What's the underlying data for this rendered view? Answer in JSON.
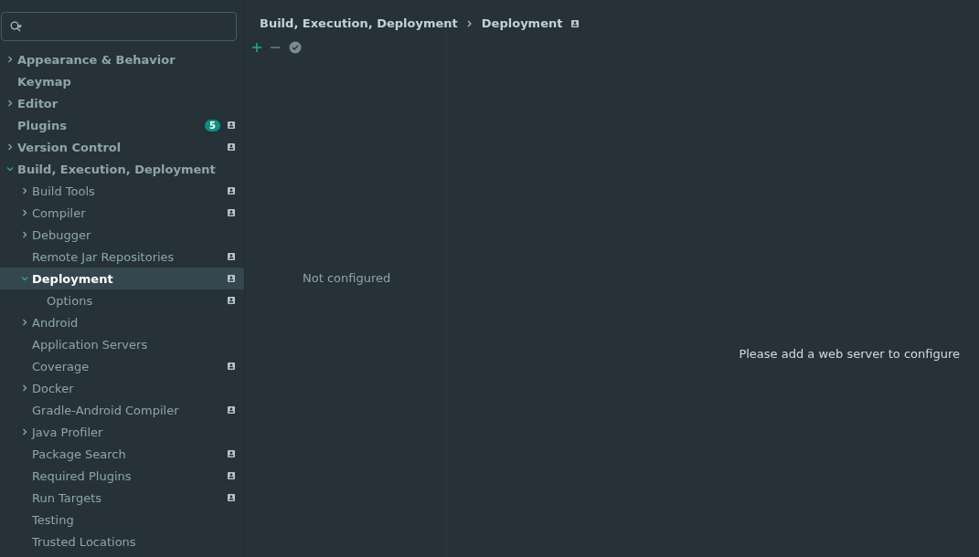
{
  "tree": [
    {
      "label": "Appearance & Behavior",
      "expandable": true,
      "expanded": false,
      "selected": false,
      "project_scope": false
    },
    {
      "label": "Keymap",
      "expandable": false,
      "selected": false,
      "project_scope": false
    },
    {
      "label": "Editor",
      "expandable": true,
      "expanded": false,
      "selected": false,
      "project_scope": false
    },
    {
      "label": "Plugins",
      "expandable": false,
      "selected": false,
      "project_scope": true,
      "badge": "5"
    },
    {
      "label": "Version Control",
      "expandable": true,
      "expanded": false,
      "selected": false,
      "project_scope": true
    },
    {
      "label": "Build, Execution, Deployment",
      "expandable": true,
      "expanded": true,
      "selected": false,
      "project_scope": false,
      "children": [
        {
          "label": "Build Tools",
          "expandable": true,
          "expanded": false,
          "selected": false,
          "project_scope": true
        },
        {
          "label": "Compiler",
          "expandable": true,
          "expanded": false,
          "selected": false,
          "project_scope": true
        },
        {
          "label": "Debugger",
          "expandable": true,
          "expanded": false,
          "selected": false,
          "project_scope": false
        },
        {
          "label": "Remote Jar Repositories",
          "expandable": false,
          "selected": false,
          "project_scope": true
        },
        {
          "label": "Deployment",
          "expandable": true,
          "expanded": true,
          "selected": true,
          "project_scope": true,
          "children": [
            {
              "label": "Options",
              "expandable": false,
              "selected": false,
              "project_scope": true
            }
          ]
        },
        {
          "label": "Android",
          "expandable": true,
          "expanded": false,
          "selected": false,
          "project_scope": false
        },
        {
          "label": "Application Servers",
          "expandable": false,
          "selected": false,
          "project_scope": false
        },
        {
          "label": "Coverage",
          "expandable": false,
          "selected": false,
          "project_scope": true
        },
        {
          "label": "Docker",
          "expandable": true,
          "expanded": false,
          "selected": false,
          "project_scope": false
        },
        {
          "label": "Gradle-Android Compiler",
          "expandable": false,
          "selected": false,
          "project_scope": true
        },
        {
          "label": "Java Profiler",
          "expandable": true,
          "expanded": false,
          "selected": false,
          "project_scope": false
        },
        {
          "label": "Package Search",
          "expandable": false,
          "selected": false,
          "project_scope": true
        },
        {
          "label": "Required Plugins",
          "expandable": false,
          "selected": false,
          "project_scope": true
        },
        {
          "label": "Run Targets",
          "expandable": false,
          "selected": false,
          "project_scope": true
        },
        {
          "label": "Testing",
          "expandable": false,
          "selected": false,
          "project_scope": false
        },
        {
          "label": "Trusted Locations",
          "expandable": false,
          "selected": false,
          "project_scope": false
        }
      ]
    }
  ],
  "breadcrumb": {
    "items": [
      "Build, Execution, Deployment",
      "Deployment"
    ],
    "project_scope": true
  },
  "toolbar": [
    {
      "kind": "add"
    },
    {
      "kind": "remove"
    },
    {
      "kind": "check"
    }
  ],
  "server_list": {
    "empty_text": "Not configured"
  },
  "details": {
    "message": "Please add a web server to configure"
  }
}
